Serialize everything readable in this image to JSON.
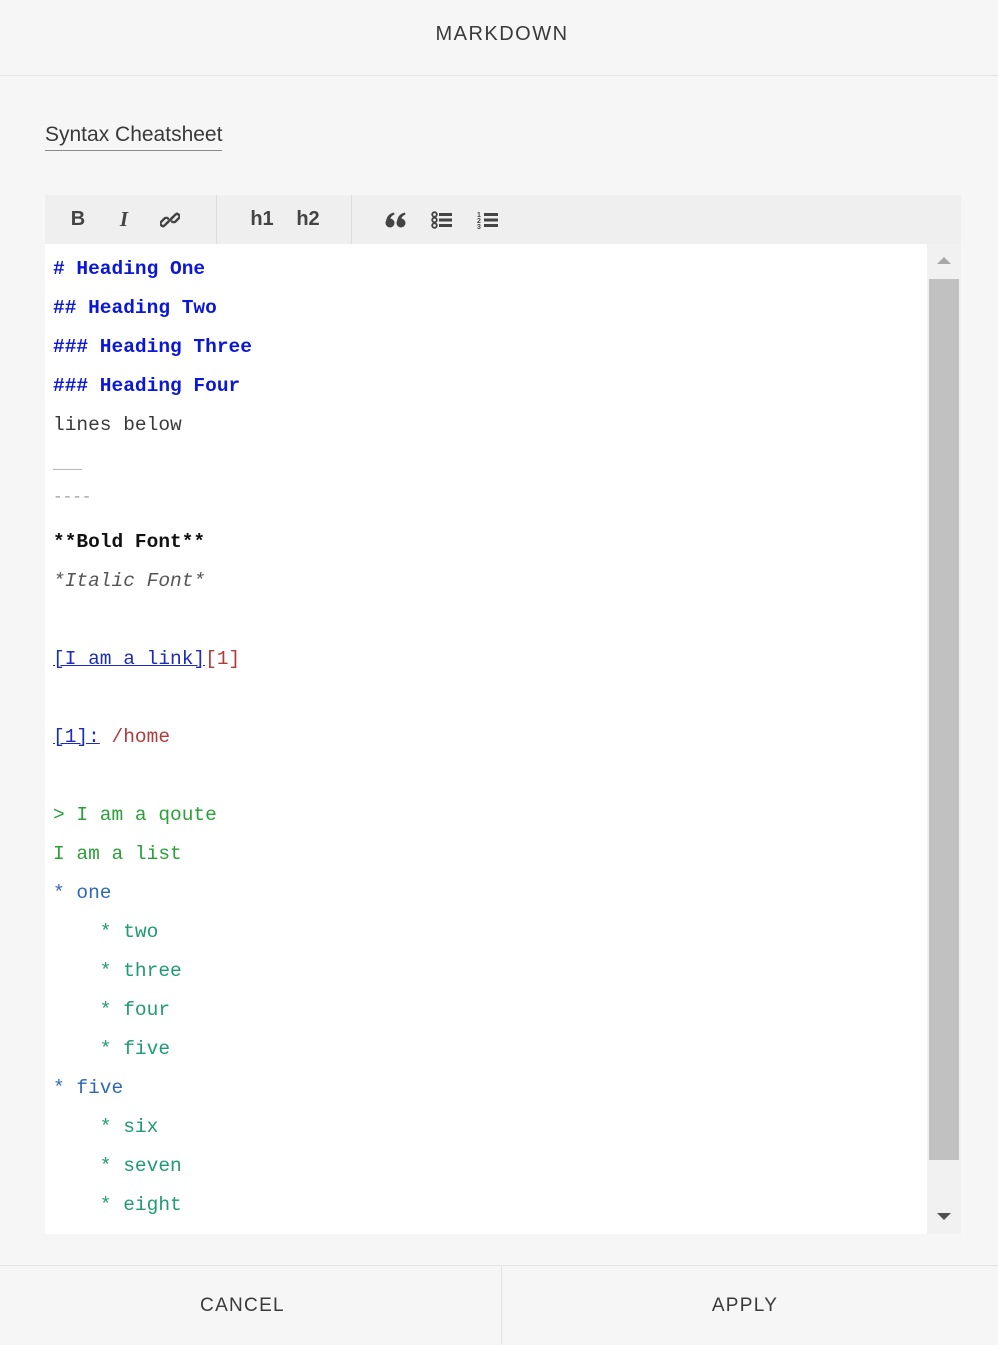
{
  "header": {
    "title": "MARKDOWN"
  },
  "cheatsheet": {
    "label": "Syntax Cheatsheet"
  },
  "toolbar": {
    "bold_label": "B",
    "italic_label": "I",
    "h1_label": "h1",
    "h2_label": "h2",
    "icons": [
      "bold-icon",
      "italic-icon",
      "link-icon",
      "h1-icon",
      "h2-icon",
      "quote-icon",
      "bulleted-list-icon",
      "numbered-list-icon"
    ]
  },
  "editor": {
    "lines": [
      "# Heading One",
      "## Heading Two",
      "### Heading Three",
      "### Heading Four",
      "lines below",
      "___",
      "----",
      "**Bold Font**",
      "*Italic Font*",
      "",
      "[I am a link]",
      "[1]",
      "",
      "[1]:",
      "/home",
      "",
      "> I am a qoute",
      "I am a list",
      "* one",
      "    * two",
      "    * three",
      "    * four",
      "    * five",
      "* five",
      "    * six",
      "    * seven",
      "    * eight"
    ]
  },
  "colors": {
    "heading": "#0b17d8",
    "link": "#1c2bb8",
    "reference": "#b33a3a",
    "quote": "#2ba03a",
    "list_level1": "#2f69b5",
    "list_level2": "#1f9a74"
  },
  "footer": {
    "cancel_label": "CANCEL",
    "apply_label": "APPLY"
  }
}
